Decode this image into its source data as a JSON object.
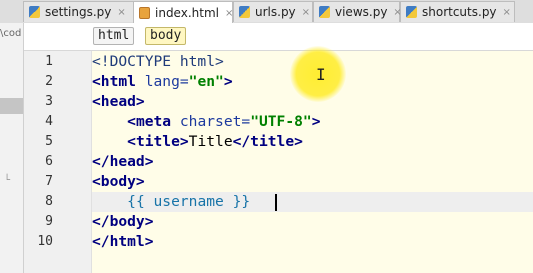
{
  "tabs": [
    {
      "label": "settings.py",
      "icon": "python-file-icon",
      "active": false
    },
    {
      "label": "index.html",
      "icon": "html-file-icon",
      "active": true
    },
    {
      "label": "urls.py",
      "icon": "python-file-icon",
      "active": false
    },
    {
      "label": "views.py",
      "icon": "python-file-icon",
      "active": false
    },
    {
      "label": "shortcuts.py",
      "icon": "python-file-icon",
      "active": false
    }
  ],
  "tab_close": "×",
  "project": {
    "path_text": "\\cod"
  },
  "breadcrumb": [
    "html",
    "body"
  ],
  "line_numbers": [
    "1",
    "2",
    "3",
    "4",
    "5",
    "6",
    "7",
    "8",
    "9",
    "10"
  ],
  "code": {
    "l1": {
      "doctype": "<!DOCTYPE html>"
    },
    "l2": {
      "open": "<html",
      "attr": "lang=",
      "val": "\"en\"",
      "close": ">"
    },
    "l3": {
      "tag": "<head>"
    },
    "l4": {
      "indent": "    ",
      "open": "<meta",
      "attr": "charset=",
      "val": "\"UTF-8\"",
      "close": ">"
    },
    "l5": {
      "indent": "    ",
      "open": "<title>",
      "text": "Title",
      "close": "</title>"
    },
    "l6": {
      "tag": "</head>"
    },
    "l7": {
      "tag": "<body>"
    },
    "l8": {
      "indent": "    ",
      "expr": "{{ username }}"
    },
    "l9": {
      "tag": "</body>"
    },
    "l10": {
      "tag": "</html>"
    }
  },
  "colors": {
    "editor_bg": "#fffde8",
    "current_line": "#eeeeee",
    "tag": "#000080",
    "string": "#008000",
    "attribute": "#1d3a9e",
    "cursor_highlight": "#ffec28"
  }
}
